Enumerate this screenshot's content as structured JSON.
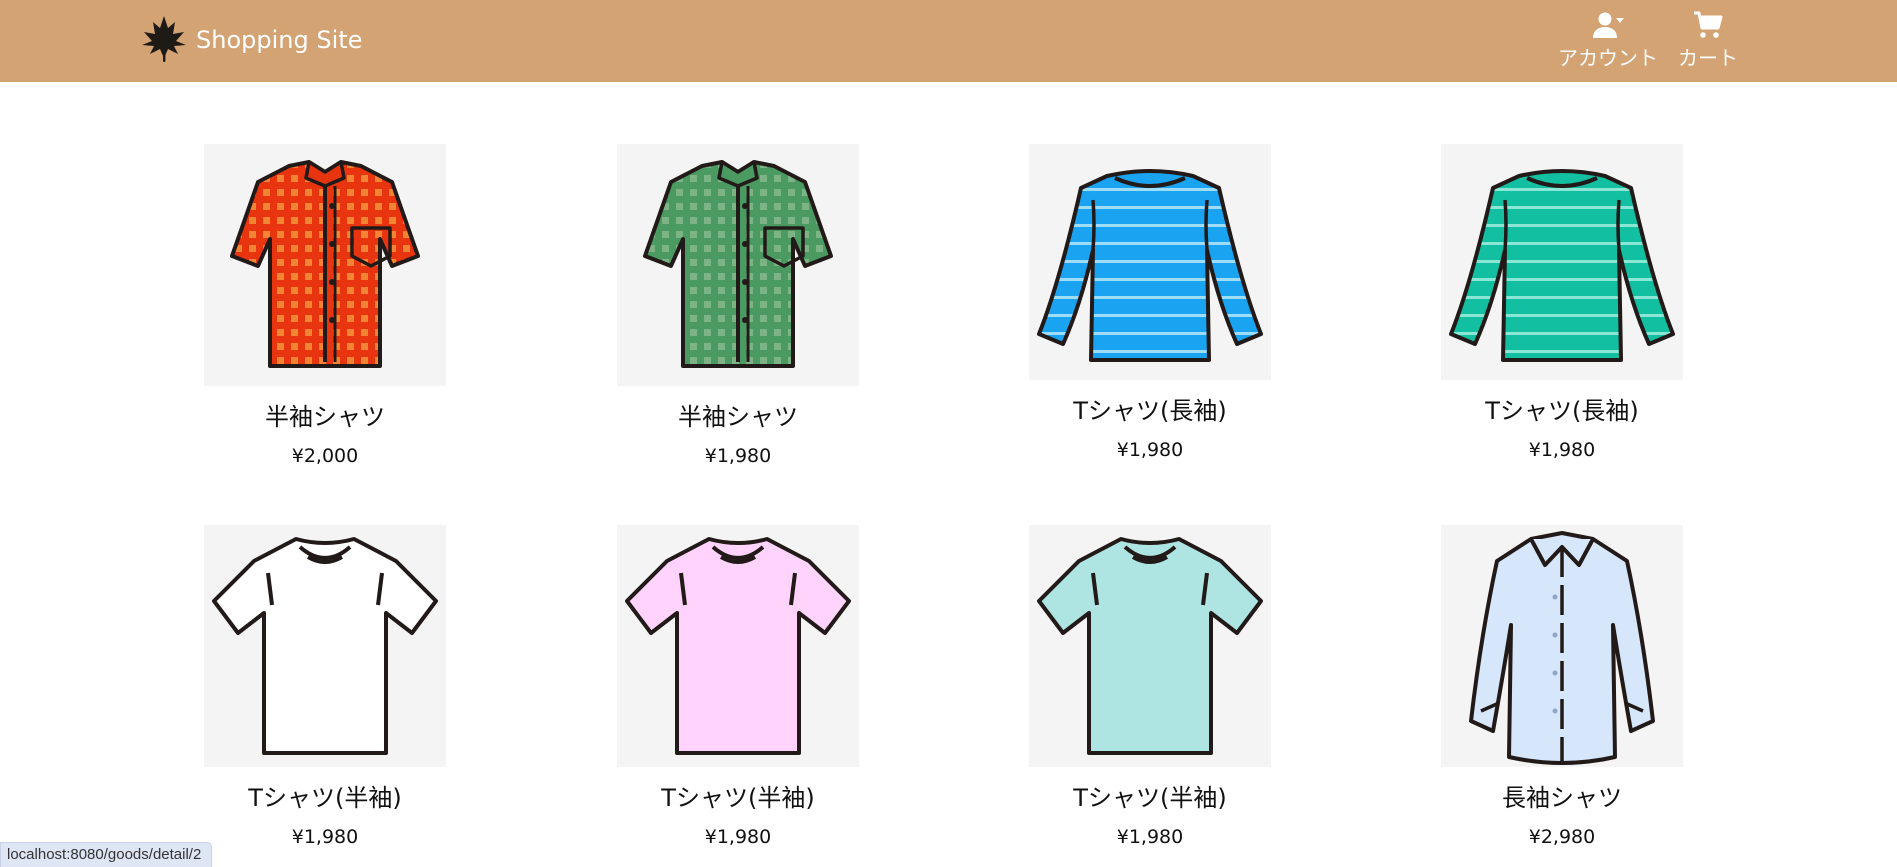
{
  "header": {
    "brand": "Shopping Site",
    "brand_icon": "leaf-logo-icon",
    "nav": [
      {
        "label": "アカウント",
        "icon": "user-dropdown-icon"
      },
      {
        "label": "カート",
        "icon": "cart-icon"
      }
    ]
  },
  "products": [
    {
      "name": "半袖シャツ",
      "price": "¥2,000",
      "image": "red-checked-shortsleeve-shirt"
    },
    {
      "name": "半袖シャツ",
      "price": "¥1,980",
      "image": "green-checked-shortsleeve-shirt"
    },
    {
      "name": "Tシャツ(長袖)",
      "price": "¥1,980",
      "image": "blue-striped-longsleeve-tshirt"
    },
    {
      "name": "Tシャツ(長袖)",
      "price": "¥1,980",
      "image": "teal-striped-longsleeve-tshirt"
    },
    {
      "name": "Tシャツ(半袖)",
      "price": "¥1,980",
      "image": "white-tshirt"
    },
    {
      "name": "Tシャツ(半袖)",
      "price": "¥1,980",
      "image": "pink-tshirt"
    },
    {
      "name": "Tシャツ(半袖)",
      "price": "¥1,980",
      "image": "mint-tshirt"
    },
    {
      "name": "長袖シャツ",
      "price": "¥2,980",
      "image": "lightblue-longsleeve-dress-shirt"
    }
  ],
  "status_bar": {
    "url": "localhost:8080/goods/detail/2"
  },
  "colors": {
    "navbar": "#d4a373",
    "image_bg": "#f4f4f4",
    "red_shirt": "#e8350f",
    "green_shirt": "#4a9a62",
    "blue_tee": "#1aa3f0",
    "teal_tee": "#12bfa0",
    "white_tee": "#ffffff",
    "pink_tee": "#ffd3fb",
    "mint_tee": "#aee5e3",
    "dress_shirt": "#d6e6fb"
  }
}
